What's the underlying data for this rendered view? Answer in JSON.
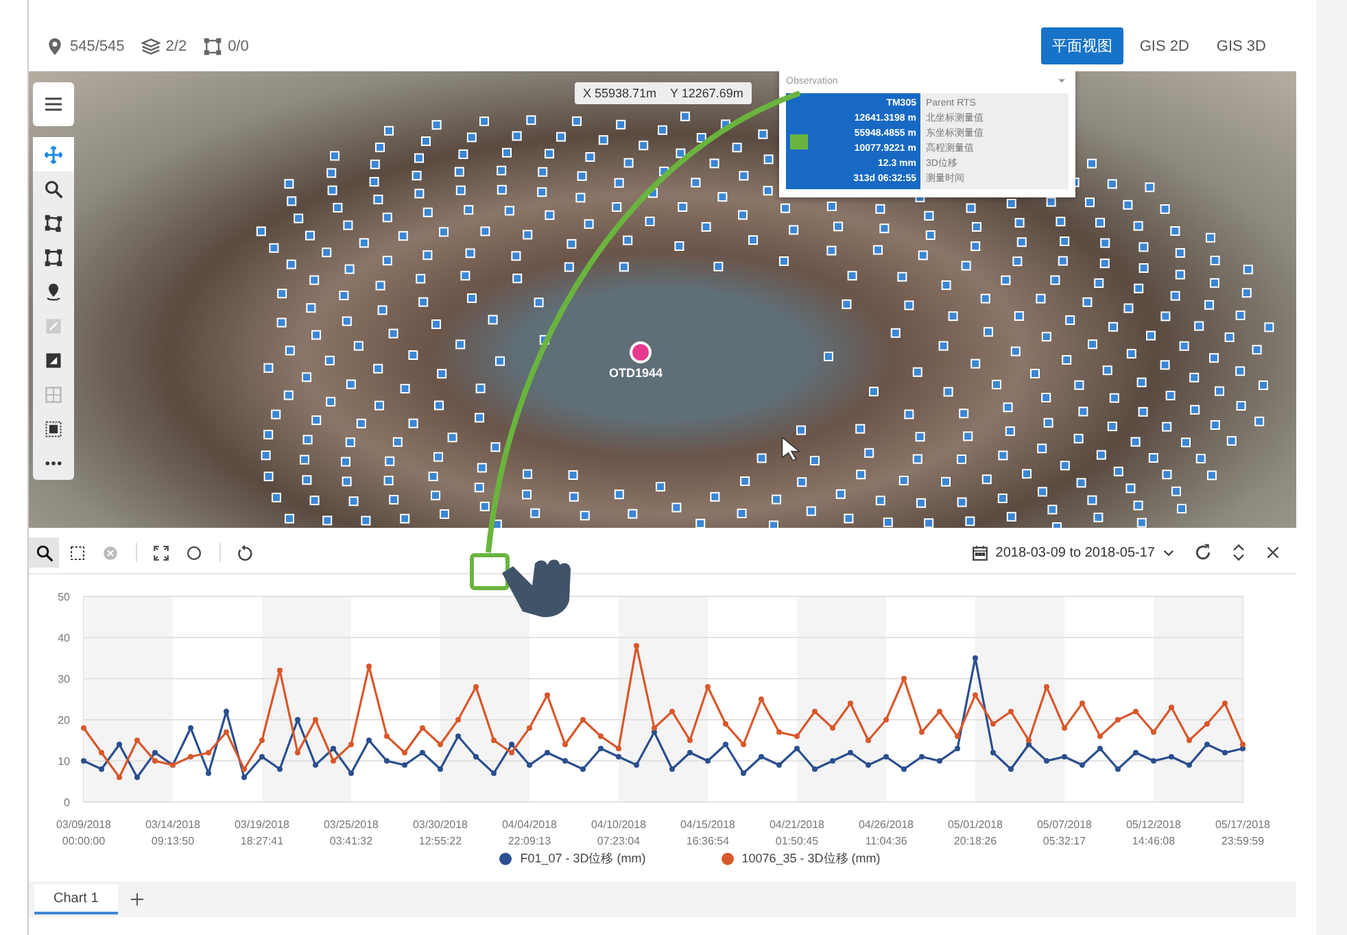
{
  "top_bar": {
    "stats": [
      {
        "kind": "pin",
        "text": "545/545"
      },
      {
        "kind": "layers",
        "text": "2/2"
      },
      {
        "kind": "selection",
        "text": "0/0"
      }
    ],
    "view_buttons": [
      {
        "label": "平面视图",
        "selected": true
      },
      {
        "label": "GIS 2D",
        "selected": false
      },
      {
        "label": "GIS 3D",
        "selected": false
      }
    ]
  },
  "map": {
    "tools": [
      {
        "kind": "pan",
        "selected": true,
        "disabled": false
      },
      {
        "kind": "zoom",
        "selected": false,
        "disabled": false
      },
      {
        "kind": "polygon",
        "selected": false,
        "disabled": false
      },
      {
        "kind": "rectangle",
        "selected": false,
        "disabled": false
      },
      {
        "kind": "location",
        "selected": false,
        "disabled": false
      },
      {
        "kind": "layer",
        "selected": false,
        "disabled": true
      },
      {
        "kind": "image",
        "selected": false,
        "disabled": false
      },
      {
        "kind": "grid",
        "selected": false,
        "disabled": true
      },
      {
        "kind": "frame",
        "selected": false,
        "disabled": false
      },
      {
        "kind": "more",
        "selected": false,
        "disabled": false
      }
    ],
    "coordinates": {
      "x": "X 55938.71m",
      "y": "Y 12267.69m"
    },
    "marker_label": "OTD1944",
    "popup": {
      "title": "Observation",
      "rows": [
        {
          "value": "TM305",
          "label": "Parent RTS"
        },
        {
          "value": "12641.3198 m",
          "label": "北坐标测量值"
        },
        {
          "value": "55948.4855 m",
          "label": "东坐标测量值"
        },
        {
          "value": "10077.9221 m",
          "label": "高程测量值"
        },
        {
          "value": "12.3 mm",
          "label": "3D位移"
        },
        {
          "value": "313d 06:32:55",
          "label": "测量时间"
        }
      ]
    }
  },
  "chart_toolbar": {
    "tools": [
      {
        "kind": "zoom",
        "selected": true,
        "disabled": false
      },
      {
        "kind": "box-select",
        "selected": false,
        "disabled": false
      },
      {
        "kind": "clear",
        "selected": false,
        "disabled": true
      },
      {
        "kind": "fit",
        "selected": false,
        "disabled": false
      },
      {
        "kind": "circle",
        "selected": false,
        "disabled": false
      },
      {
        "kind": "reset",
        "selected": false,
        "disabled": false
      }
    ],
    "date_range": "2018-03-09 to 2018-05-17"
  },
  "chart": {
    "chart_data": {
      "type": "line",
      "grid": true,
      "ylim": [
        0,
        50
      ],
      "yticks": [
        0,
        10,
        20,
        30,
        40,
        50
      ],
      "categories": [
        "03/09/2018 00:00:00",
        null,
        null,
        null,
        null,
        "03/14/2018 09:13:50",
        null,
        null,
        null,
        null,
        "03/19/2018 18:27:41",
        null,
        null,
        null,
        null,
        "03/25/2018 03:41:32",
        null,
        null,
        null,
        null,
        "03/30/2018 12:55:22",
        null,
        null,
        null,
        null,
        "04/04/2018 22:09:13",
        null,
        null,
        null,
        null,
        "04/10/2018 07:23:04",
        null,
        null,
        null,
        null,
        "04/15/2018 16:36:54",
        null,
        null,
        null,
        null,
        "04/21/2018 01:50:45",
        null,
        null,
        null,
        null,
        "04/26/2018 11:04:36",
        null,
        null,
        null,
        null,
        "05/01/2018 20:18:26",
        null,
        null,
        null,
        null,
        "05/07/2018 05:32:17",
        null,
        null,
        null,
        null,
        "05/12/2018 14:46:08",
        null,
        null,
        null,
        null,
        "05/17/2018 23:59:59"
      ],
      "series": [
        {
          "name": "F01_07 - 3D位移 (mm)",
          "color": "#2a4f8f",
          "marker": "circle",
          "values": [
            10,
            8,
            14,
            6,
            12,
            9,
            18,
            7,
            22,
            6,
            11,
            8,
            20,
            9,
            13,
            7,
            15,
            10,
            9,
            12,
            8,
            16,
            11,
            7,
            14,
            9,
            12,
            10,
            8,
            13,
            11,
            9,
            17,
            8,
            12,
            10,
            14,
            7,
            11,
            9,
            13,
            8,
            10,
            12,
            9,
            11,
            8,
            11,
            10,
            13,
            35,
            12,
            8,
            14,
            10,
            11,
            9,
            13,
            8,
            12,
            10,
            11,
            9,
            14,
            12,
            13
          ]
        },
        {
          "name": "10076_35 - 3D位移 (mm)",
          "color": "#d9572b",
          "marker": "circle",
          "values": [
            18,
            12,
            6,
            15,
            10,
            9,
            11,
            12,
            17,
            8,
            15,
            32,
            12,
            20,
            10,
            14,
            33,
            16,
            12,
            18,
            14,
            20,
            28,
            15,
            12,
            18,
            26,
            14,
            20,
            16,
            13,
            38,
            18,
            22,
            15,
            28,
            19,
            14,
            25,
            17,
            16,
            22,
            18,
            24,
            15,
            20,
            30,
            17,
            22,
            16,
            26,
            19,
            22,
            15,
            28,
            18,
            24,
            16,
            20,
            22,
            17,
            23,
            15,
            19,
            24,
            14
          ]
        }
      ]
    }
  },
  "chart_tabs": [
    {
      "label": "Chart 1",
      "selected": true
    }
  ]
}
